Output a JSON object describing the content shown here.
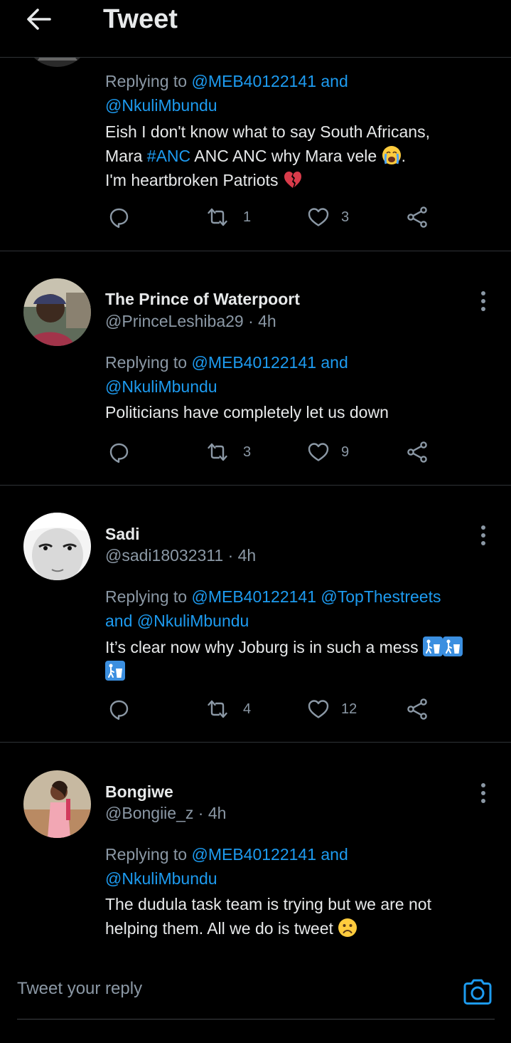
{
  "header": {
    "title": "Tweet",
    "back_icon": "arrow-left-icon"
  },
  "colors": {
    "background": "#000000",
    "accent": "#1d9bf0",
    "muted": "#8b98a5",
    "divider": "#2f3336"
  },
  "tweets": [
    {
      "replying_prefix": "Replying to ",
      "mentions": [
        "@MEB40122141",
        "and",
        "@NkuliMbundu"
      ],
      "text_parts": [
        "Eish I don't know what to say South Africans,",
        "Mara ",
        "#ANC",
        " ANC ANC why Mara vele ",
        ".",
        "I'm heartbroken Patriots "
      ],
      "emojis": [
        "crying-face-emoji",
        "broken-heart-emoji"
      ],
      "retweets": "1",
      "likes": "3"
    },
    {
      "name": "The Prince of Waterpoort",
      "handle": "@PrinceLeshiba29",
      "time": "· 4h",
      "replying_prefix": "Replying to ",
      "mentions": [
        "@MEB40122141",
        "and",
        "@NkuliMbundu"
      ],
      "text": "Politicians have completely let us down",
      "retweets": "3",
      "likes": "9"
    },
    {
      "name": "Sadi",
      "handle": "@sadi18032311",
      "time": "· 4h",
      "replying_prefix": "Replying to ",
      "mentions": [
        "@MEB40122141",
        "@TopThestreets",
        "and",
        "@NkuliMbundu"
      ],
      "text": "It’s clear now why Joburg is in such a mess ",
      "emojis": [
        "litter-bin-emoji",
        "litter-bin-emoji",
        "litter-bin-emoji"
      ],
      "retweets": "4",
      "likes": "12"
    },
    {
      "name": "Bongiwe",
      "handle": "@Bongiie_z",
      "time": "· 4h",
      "replying_prefix": "Replying to ",
      "mentions": [
        "@MEB40122141",
        "and",
        "@NkuliMbundu"
      ],
      "text_parts": [
        "The dudula task team is trying but we are not",
        "helping them. All we do is tweet "
      ],
      "emojis": [
        "frowning-face-emoji"
      ]
    }
  ],
  "action_icons": [
    "reply-icon",
    "retweet-icon",
    "like-icon",
    "share-icon"
  ],
  "composer": {
    "placeholder": "Tweet your reply",
    "camera_icon": "camera-icon"
  }
}
